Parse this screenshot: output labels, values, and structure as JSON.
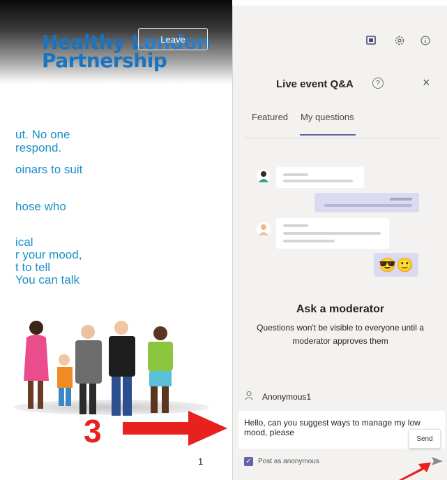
{
  "slide": {
    "logo_line1": "Healthy London",
    "logo_line2": "Partnership",
    "leave_label": "Leave",
    "text_lines": [
      "ut. No one",
      "respond.",
      "oinars to suit",
      "hose who",
      "ical",
      "r your mood,",
      "t to tell",
      "You can talk"
    ],
    "page_number": "1"
  },
  "annotation": {
    "step": "3"
  },
  "panel": {
    "title": "Live event Q&A",
    "help_glyph": "?",
    "close_glyph": "×",
    "tabs": [
      {
        "label": "Featured",
        "active": false
      },
      {
        "label": "My questions",
        "active": true
      }
    ],
    "emojis": "😎🙂",
    "ask_title": "Ask a moderator",
    "ask_sub": "Questions won't be visible to everyone until a moderator approves them",
    "user_name": "Anonymous1",
    "input_value": "Hello, can you suggest ways to manage my low mood, please",
    "tooltip": "Send",
    "checkbox_label": "Post as anonymous",
    "checkbox_checked": true,
    "icons": [
      "reader-icon",
      "gear-icon",
      "info-icon",
      "help-icon",
      "close-icon",
      "person-icon",
      "send-icon"
    ]
  },
  "colors": {
    "accent": "#6264a7",
    "brand_blue": "#1a74c0",
    "slide_text": "#1b8fc6",
    "annotation_red": "#e8201e",
    "panel_bg": "#f3f2f1",
    "bubble_self": "#dcdaf0"
  }
}
